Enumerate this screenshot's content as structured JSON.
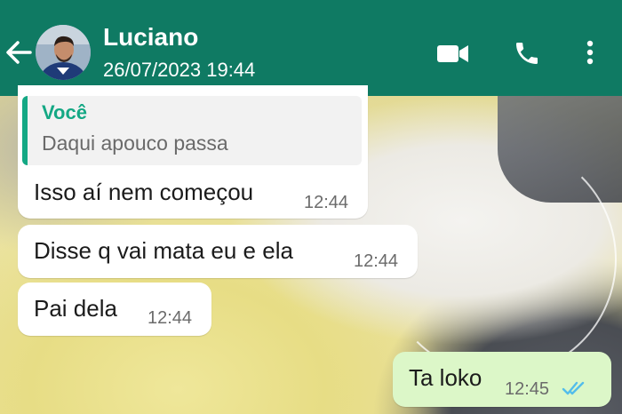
{
  "header": {
    "contact_name": "Luciano",
    "last_seen": "26/07/2023 19:44",
    "icons": [
      "back-arrow-icon",
      "avatar",
      "video-call-icon",
      "phone-call-icon",
      "more-options-icon"
    ],
    "bg_color": "#0f7a63"
  },
  "messages": [
    {
      "direction": "in",
      "quoted_author": "Você",
      "quoted_text": "Daqui apouco passa",
      "text": "Isso aí nem começou",
      "time": "12:44"
    },
    {
      "direction": "in",
      "text": "Disse  q vai mata  eu e ela",
      "time": "12:44"
    },
    {
      "direction": "in",
      "text": "Pai dela",
      "time": "12:44"
    },
    {
      "direction": "out",
      "text": "Ta loko",
      "time": "12:45",
      "status": "read",
      "status_icon": "double-check-icon"
    }
  ],
  "colors": {
    "outgoing_bubble": "#dcf7c8",
    "incoming_bubble": "#ffffff",
    "accent": "#14a884",
    "read_ticks": "#53bdeb"
  }
}
